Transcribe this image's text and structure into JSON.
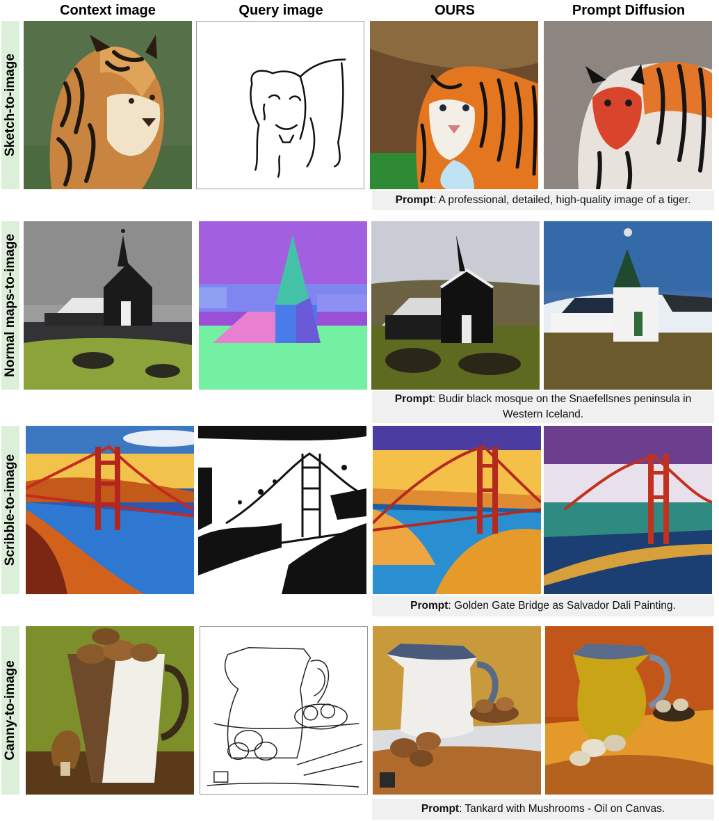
{
  "headers": [
    "Context image",
    "Query image",
    "OURS",
    "Prompt Diffusion"
  ],
  "rows": [
    {
      "label": "Sketch-to-image",
      "prompt_label": "Prompt",
      "prompt_text": ": A professional, detailed, high-quality image of a tiger."
    },
    {
      "label": "Normal maps-to-image",
      "prompt_label": "Prompt",
      "prompt_text": ": Budir black mosque on the Snaefellsnes peninsula in Western Iceland."
    },
    {
      "label": "Scribble-to-image",
      "prompt_label": "Prompt",
      "prompt_text": ": Golden Gate Bridge as Salvador Dali Painting."
    },
    {
      "label": "Canny-to-image",
      "prompt_label": "Prompt",
      "prompt_text": ": Tankard with Mushrooms - Oil on Canvas."
    }
  ],
  "colors": {
    "row_label_bg": "#dcefd9",
    "prompt_bg": "#f0f0f0"
  }
}
